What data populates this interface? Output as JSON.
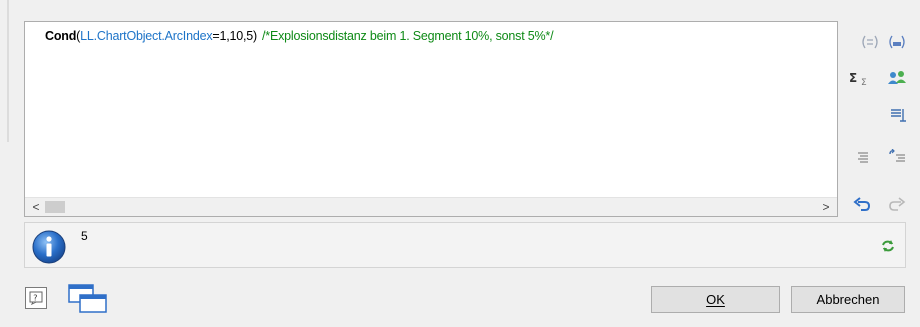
{
  "editor": {
    "code": {
      "function": "Cond",
      "open_paren": "(",
      "field": "LL.ChartObject.ArcIndex",
      "operator_args": "=1,10,5)",
      "comment": "/*Explosionsdistanz beim 1. Segment 10%, sonst 5%*/"
    },
    "scroll_left_arrow": "<",
    "scroll_right_arrow": ">"
  },
  "toolbar": {
    "icons": [
      "format-parentheses-icon",
      "format-brackets-icon",
      "sum-icon",
      "users-icon",
      "filter-icon",
      "indent-icon",
      "outdent-icon",
      "undo-icon",
      "redo-icon"
    ]
  },
  "result": {
    "value": "5"
  },
  "buttons": {
    "ok_label": "OK",
    "cancel_label": "Abbrechen"
  },
  "colors": {
    "field_blue": "#1e74c8",
    "comment_green": "#0e8a16",
    "icon_blue": "#2f6fc8"
  }
}
